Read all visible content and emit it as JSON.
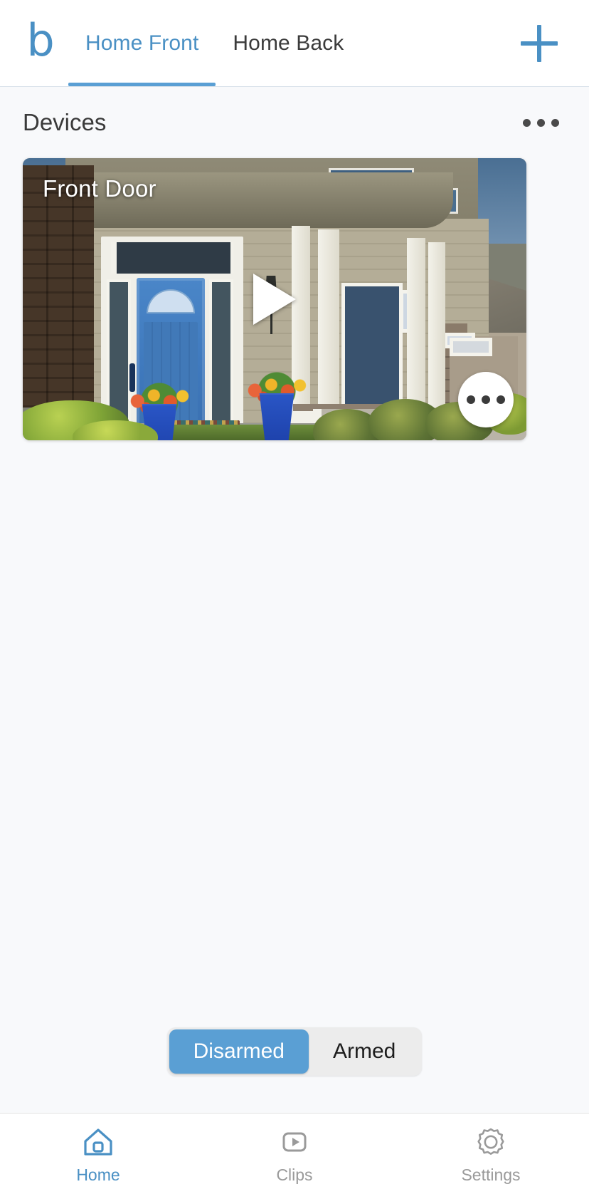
{
  "app": {
    "logo_letter": "b",
    "brand_color": "#4a90c4"
  },
  "topbar": {
    "tabs": [
      {
        "label": "Home Front",
        "active": true
      },
      {
        "label": "Home Back",
        "active": false
      }
    ],
    "add_icon": "plus-icon",
    "add_label": "+"
  },
  "section": {
    "title": "Devices",
    "overflow_icon": "ellipsis-horizontal-icon"
  },
  "camera": {
    "name": "Front Door",
    "play_icon": "play-triangle-icon",
    "more_icon": "ellipsis-horizontal-icon",
    "scene_description": "Front porch of a craftsman home with a blue front door, white columns, stone veneer and blue flower planters"
  },
  "arm_toggle": {
    "options": [
      {
        "label": "Disarmed",
        "active": true
      },
      {
        "label": "Armed",
        "active": false
      }
    ],
    "active_color": "#5a9fd4",
    "track_color": "#ececec"
  },
  "bottom_nav": {
    "items": [
      {
        "label": "Home",
        "icon": "home-icon",
        "active": true
      },
      {
        "label": "Clips",
        "icon": "clips-play-icon",
        "active": false
      },
      {
        "label": "Settings",
        "icon": "gear-icon",
        "active": false
      }
    ],
    "active_color": "#4a90c4",
    "inactive_color": "#9a9a9a"
  }
}
